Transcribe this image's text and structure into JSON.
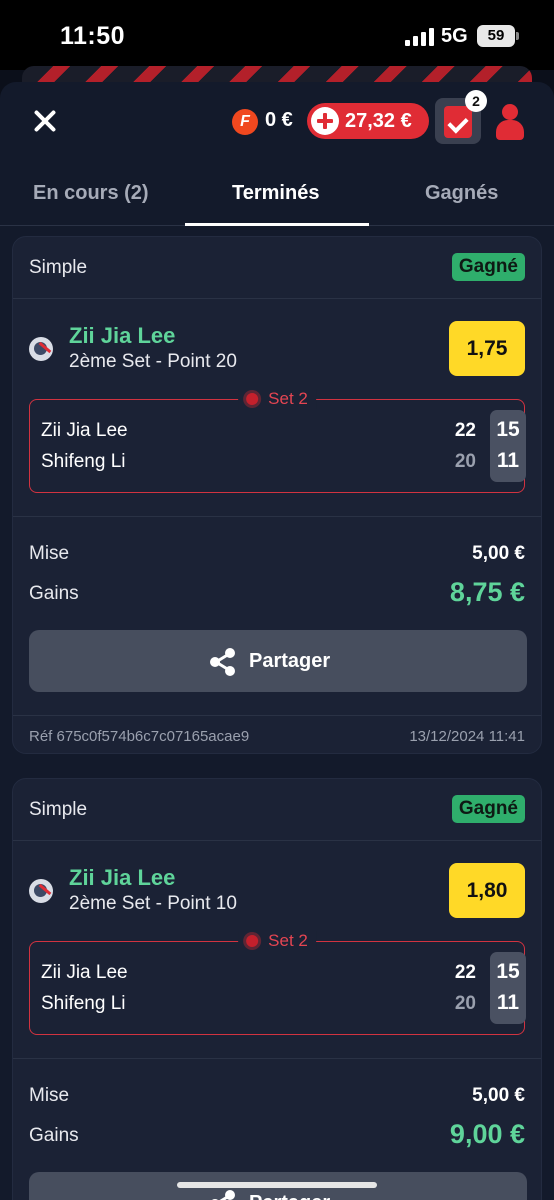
{
  "status_bar": {
    "time": "11:50",
    "network": "5G",
    "battery": "59"
  },
  "header": {
    "freebet_coin": "F",
    "freebet_balance": "0 €",
    "wallet_balance": "27,32 €",
    "betslip_count": "2"
  },
  "tabs": [
    {
      "label": "En cours (2)",
      "active": false
    },
    {
      "label": "Terminés",
      "active": true
    },
    {
      "label": "Gagnés",
      "active": false
    }
  ],
  "bets": [
    {
      "type": "Simple",
      "status": "Gagné",
      "player": "Zii Jia Lee",
      "market": "2ème Set - Point 20",
      "odds": "1,75",
      "set_label": "Set 2",
      "team1": "Zii Jia Lee",
      "team1_points": "22",
      "team1_set": "15",
      "team2": "Shifeng Li",
      "team2_points": "20",
      "team2_set": "11",
      "stake_label": "Mise",
      "stake": "5,00 €",
      "gains_label": "Gains",
      "gains": "8,75 €",
      "share_label": "Partager",
      "ref": "Réf 675c0f574b6c7c07165acae9",
      "date": "13/12/2024 11:41"
    },
    {
      "type": "Simple",
      "status": "Gagné",
      "player": "Zii Jia Lee",
      "market": "2ème Set - Point 10",
      "odds": "1,80",
      "set_label": "Set 2",
      "team1": "Zii Jia Lee",
      "team1_points": "22",
      "team1_set": "15",
      "team2": "Shifeng Li",
      "team2_points": "20",
      "team2_set": "11",
      "stake_label": "Mise",
      "stake": "5,00 €",
      "gains_label": "Gains",
      "gains": "9,00 €",
      "share_label": "Partager"
    }
  ],
  "colors": {
    "background": "#131a2b",
    "card": "#1b2235",
    "accent_red": "#e02c35",
    "win_green": "#5fd49a",
    "odds_yellow": "#ffd927"
  }
}
